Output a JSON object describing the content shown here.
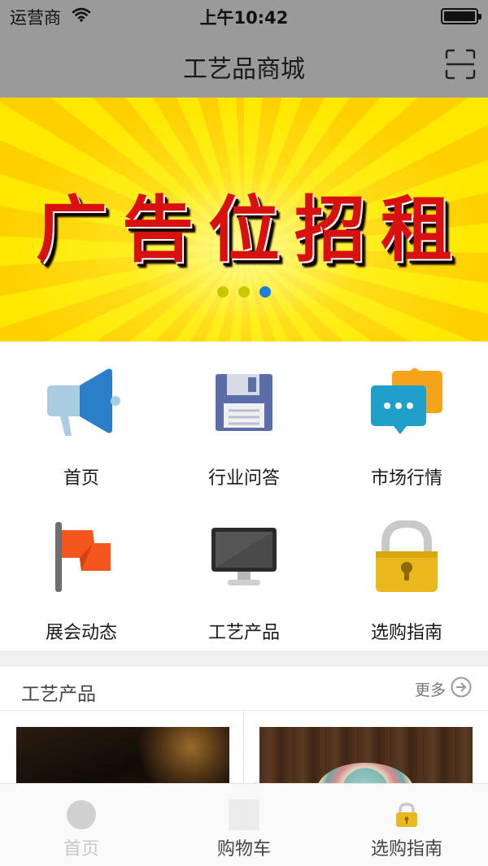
{
  "status_bar": {
    "carrier": "运营商",
    "time": "上午10:42",
    "battery_level": 1.0
  },
  "nav": {
    "title": "工艺品商城",
    "scan_icon": "scan-icon"
  },
  "banner": {
    "text": "广告位招租",
    "dot_count": 3,
    "active_dot": 3
  },
  "grid": {
    "items": [
      {
        "label": "首页",
        "icon": "megaphone-icon"
      },
      {
        "label": "行业问答",
        "icon": "floppy-disk-icon"
      },
      {
        "label": "市场行情",
        "icon": "chat-bubbles-icon"
      },
      {
        "label": "展会动态",
        "icon": "flag-icon"
      },
      {
        "label": "工艺产品",
        "icon": "monitor-icon"
      },
      {
        "label": "选购指南",
        "icon": "padlock-icon"
      }
    ]
  },
  "section": {
    "title": "工艺产品",
    "more_label": "更多"
  },
  "tabbar": {
    "tabs": [
      {
        "label": "首页",
        "icon": "home-circle-icon"
      },
      {
        "label": "购物车",
        "icon": "cart-square-icon"
      },
      {
        "label": "选购指南",
        "icon": "padlock-icon"
      }
    ]
  },
  "colors": {
    "bar_gray": "#9a9a9a",
    "active_dot": "#1e7fe0",
    "banner_yellow": "#ffe800",
    "ad_red": "#d81010"
  }
}
